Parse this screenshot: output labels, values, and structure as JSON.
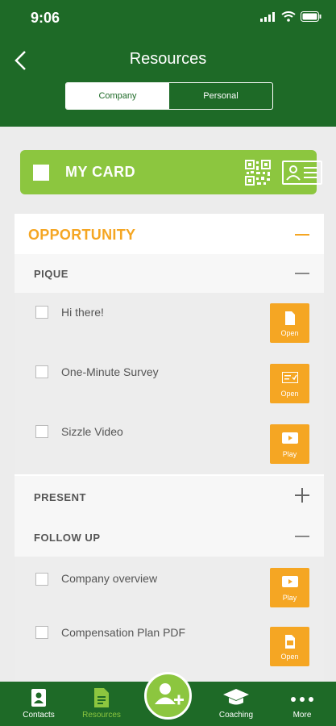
{
  "status": {
    "time": "9:06"
  },
  "header": {
    "title": "Resources"
  },
  "tabs": [
    {
      "label": "Company",
      "selected": true
    },
    {
      "label": "Personal",
      "selected": false
    }
  ],
  "my_card": {
    "label": "MY CARD",
    "icons": [
      "qr-code-icon",
      "id-card-icon"
    ]
  },
  "opportunity": {
    "title": "OPPORTUNITY"
  },
  "sections": {
    "pique": {
      "label": "PIQUE",
      "expanded": true
    },
    "present": {
      "label": "PRESENT",
      "expanded": false
    },
    "follow_up": {
      "label": "FOLLOW UP",
      "expanded": true
    }
  },
  "pique_items": [
    {
      "label": "Hi there!",
      "action": "Open",
      "icon": "document-icon"
    },
    {
      "label": "One-Minute Survey",
      "action": "Open",
      "icon": "survey-icon"
    },
    {
      "label": "Sizzle Video",
      "action": "Play",
      "icon": "play-icon"
    }
  ],
  "follow_up_items": [
    {
      "label": "Company overview",
      "action": "Play",
      "icon": "play-icon"
    },
    {
      "label": "Compensation Plan PDF",
      "action": "Open",
      "icon": "pdf-icon"
    }
  ],
  "nav": [
    {
      "label": "Contacts",
      "icon": "contacts-icon",
      "active": false
    },
    {
      "label": "Resources",
      "icon": "resources-icon",
      "active": true
    },
    {
      "label": "Coaching",
      "icon": "graduation-cap-icon",
      "active": false
    },
    {
      "label": "More",
      "icon": "more-icon",
      "active": false
    }
  ],
  "colors": {
    "primary": "#1e6a27",
    "accent": "#8cc63f",
    "orange": "#f5a623"
  }
}
